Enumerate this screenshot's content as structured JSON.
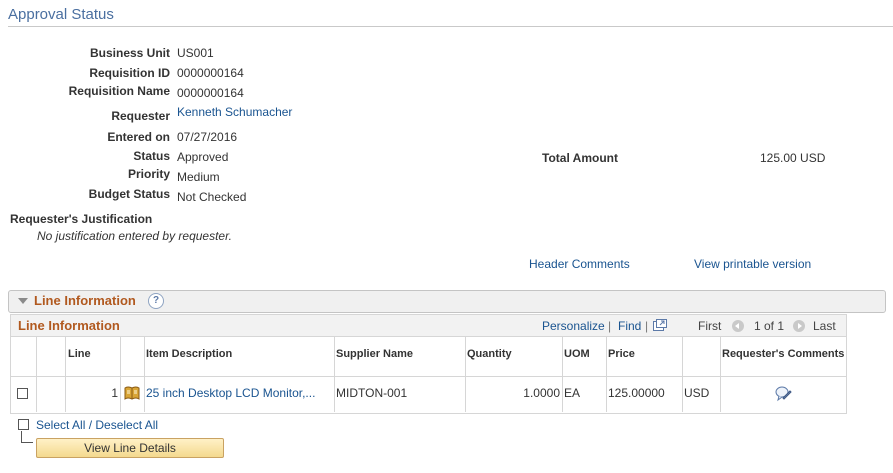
{
  "page": {
    "title": "Approval Status"
  },
  "header": {
    "business_unit": {
      "label": "Business Unit",
      "value": "US001"
    },
    "requisition_id": {
      "label": "Requisition ID",
      "value": "0000000164"
    },
    "requisition_name": {
      "label": "Requisition Name",
      "value": "0000000164"
    },
    "requester": {
      "label": "Requester",
      "value": "Kenneth Schumacher"
    },
    "entered_on": {
      "label": "Entered on",
      "value": "07/27/2016"
    },
    "status": {
      "label": "Status",
      "value": "Approved"
    },
    "priority": {
      "label": "Priority",
      "value": "Medium"
    },
    "budget_status": {
      "label": "Budget Status",
      "value": "Not Checked"
    },
    "total_amount": {
      "label": "Total Amount",
      "value": "125.00 USD"
    },
    "justification": {
      "label": "Requester's Justification",
      "value": "No justification entered by requester."
    },
    "links": {
      "header_comments": "Header Comments",
      "printable": "View printable version"
    }
  },
  "line_section": {
    "title": "Line Information",
    "help": "?",
    "grid": {
      "title": "Line Information",
      "personalize": "Personalize",
      "sep": "|",
      "find": "Find",
      "first": "First",
      "range": "1 of 1",
      "last": "Last",
      "columns": [
        "Line",
        "Item Description",
        "Supplier Name",
        "Quantity",
        "UOM",
        "Price",
        "Requester's Comments"
      ],
      "rows": [
        {
          "line": "1",
          "item_description": "25 inch Desktop LCD Monitor,...",
          "supplier": "MIDTON-001",
          "quantity": "1.0000",
          "uom": "EA",
          "price": "125.00000",
          "currency": "USD"
        }
      ]
    },
    "select_all": "Select All / Deselect All",
    "view_line_details": "View Line Details"
  },
  "colors": {
    "link": "#1a5490",
    "section_title": "#b1591f",
    "page_title": "#4a6fa0"
  }
}
